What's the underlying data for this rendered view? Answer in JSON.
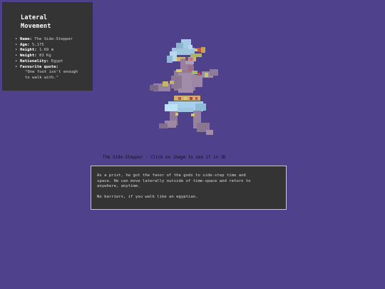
{
  "info_card": {
    "title_line1": "Lateral",
    "title_line2": "Movement",
    "facts": [
      {
        "key": "Name:",
        "value": "The Side-Stepper"
      },
      {
        "key": "Age:",
        "value": "5,175"
      },
      {
        "key": "Height:",
        "value": "1.69 m"
      },
      {
        "key": "Weight:",
        "value": "83 Kg"
      },
      {
        "key": "Nationality:",
        "value": "Egypt"
      },
      {
        "key": "Favourite quote:",
        "value": "\"One foot isn't enough",
        "value2": "to walk with.\""
      }
    ]
  },
  "figure": {
    "icon": "voxel-egyptian-figure"
  },
  "caption": {
    "text": "The Side-Stepper - Click on image to see it in 3D"
  },
  "story": {
    "line1": "As a prist, he got the favor of the gods to side-step time and",
    "line2": "space. He can move laterally outside of time-space and return to",
    "line3": "anywhere, anytime.",
    "line4": "No barriers, if you walk like an egyptian."
  }
}
